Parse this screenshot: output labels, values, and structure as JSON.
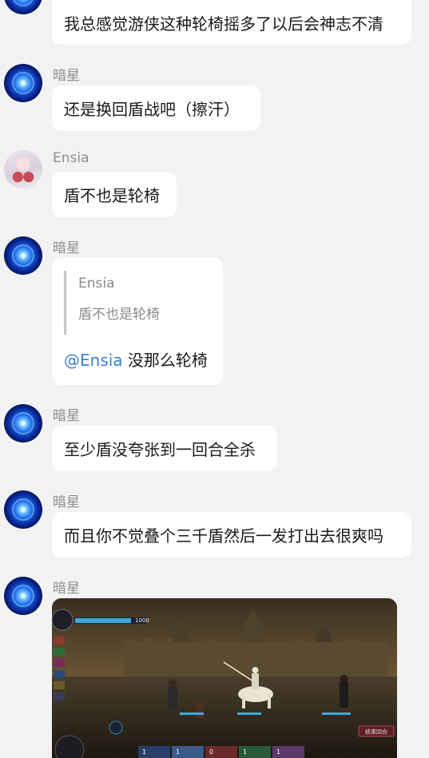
{
  "messages": [
    {
      "text": "我总感觉游侠这种轮椅摇多了以后会神志不清"
    },
    {
      "sender": "暗星",
      "text": "还是换回盾战吧（擦汗）"
    },
    {
      "sender": "Ensia",
      "text": "盾不也是轮椅"
    },
    {
      "sender": "暗星",
      "quote": {
        "name": "Ensia",
        "text": "盾不也是轮椅"
      },
      "mention": "@Ensia",
      "text": " 没那么轮椅"
    },
    {
      "sender": "暗星",
      "text": "至少盾没夸张到一回合全杀"
    },
    {
      "sender": "暗星",
      "text": "而且你不觉叠个三千盾然后一发打出去很爽吗"
    },
    {
      "sender": "暗星",
      "image": "game-battle-screenshot",
      "hud": {
        "hp": "1000",
        "button": "结束回合",
        "card_costs": [
          "1",
          "1",
          "0",
          "1",
          "1"
        ]
      }
    }
  ],
  "colors": {
    "background": "#f2f2f2",
    "bubble": "#ffffff",
    "mention": "#3d7fd6",
    "name": "#8f8f8f"
  }
}
